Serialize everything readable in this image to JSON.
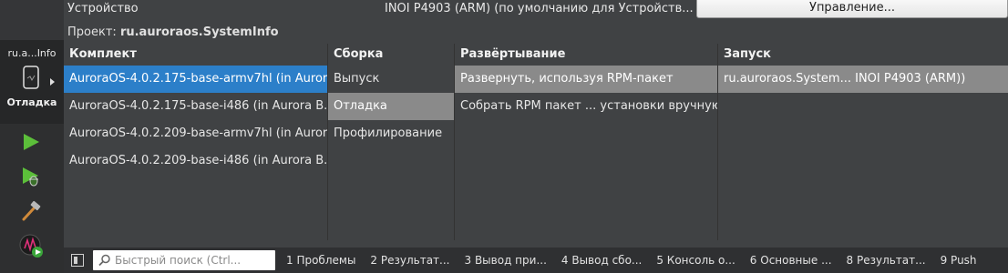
{
  "left_bar": {
    "kit_name": "ru.a...Info",
    "kit_mode": "Отладка",
    "tools": [
      "run-icon",
      "debug-run-icon",
      "build-hammer-icon",
      "aurora-analyzer-icon"
    ]
  },
  "device": {
    "label": "Устройство",
    "value": "INOI P4903 (ARM) (по умолчанию для Устройств...",
    "manage_label": "Управление..."
  },
  "project": {
    "label": "Проект:",
    "value": "ru.auroraos.SystemInfo"
  },
  "columns": {
    "kit": {
      "header": "Комплект",
      "items": [
        "AuroraOS-4.0.2.175-base-armv7hl (in Auror...",
        "AuroraOS-4.0.2.175-base-i486 (in Aurora B...",
        "AuroraOS-4.0.2.209-base-armv7hl (in Auror...",
        "AuroraOS-4.0.2.209-base-i486 (in Aurora B..."
      ]
    },
    "build": {
      "header": "Сборка",
      "items": [
        "Выпуск",
        "Отладка",
        "Профилирование"
      ]
    },
    "deploy": {
      "header": "Развёртывание",
      "items": [
        "Развернуть, используя RPM-пакет",
        "Собрать RPM пакет ... установки вручную"
      ]
    },
    "run": {
      "header": "Запуск",
      "items": [
        "ru.auroraos.System... INOI P4903 (ARM))"
      ]
    }
  },
  "bottom": {
    "search_placeholder": "Быстрый поиск (Ctrl...",
    "tabs": [
      "1  Проблемы",
      "2  Результат...",
      "3  Вывод при...",
      "4  Вывод сбо...",
      "5  Консоль о...",
      "6  Основные ...",
      "8  Результат...",
      "9  Push"
    ]
  },
  "colors": {
    "selection_blue": "#2c7fc9",
    "selection_gray": "#8a8a8a",
    "background": "#404244"
  }
}
